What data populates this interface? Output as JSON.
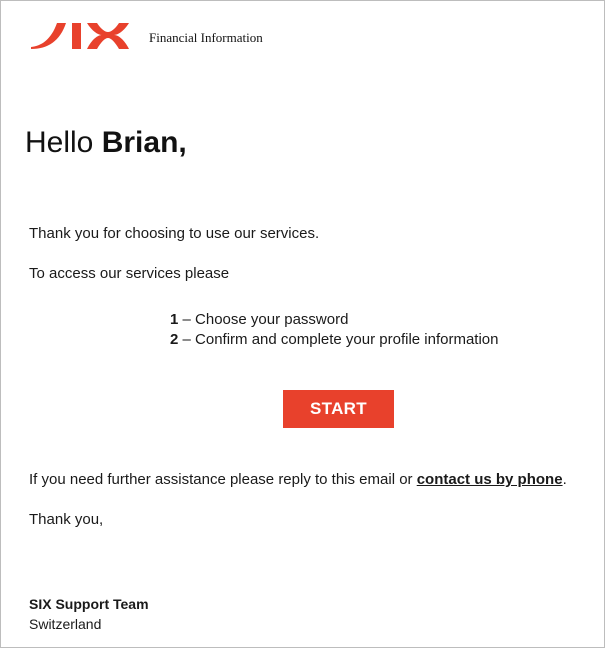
{
  "header": {
    "logo_text": "SIX",
    "subtitle": "Financial Information"
  },
  "colors": {
    "brand_red": "#e8412c"
  },
  "greeting": {
    "prefix": "Hello ",
    "name": "Brian,"
  },
  "body": {
    "thanks_line": "Thank you for choosing to use our services.",
    "access_line": "To access our services please",
    "steps": [
      {
        "num": "1",
        "text": " – Choose your password"
      },
      {
        "num": "2",
        "text": " – Confirm and complete your profile information"
      }
    ],
    "start_label": "START",
    "assist_prefix": "If you need further assistance please reply to this email or ",
    "assist_link": "contact us by phone",
    "assist_suffix": ".",
    "closing": "Thank you,"
  },
  "signature": {
    "team": "SIX Support Team",
    "location": "Switzerland"
  }
}
